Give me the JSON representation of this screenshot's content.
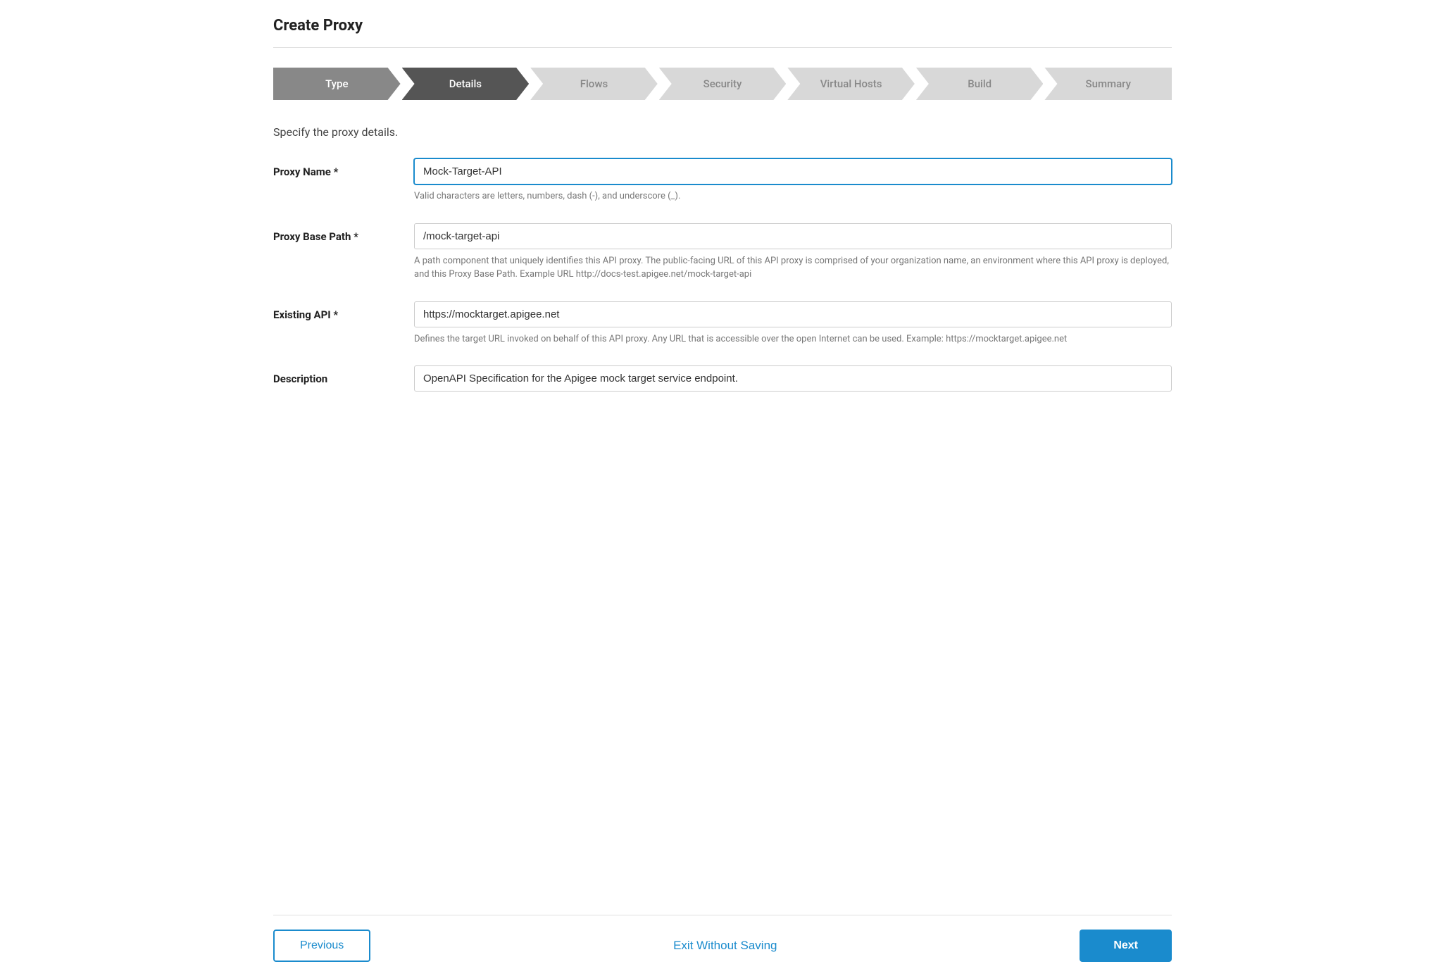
{
  "page": {
    "title": "Create Proxy"
  },
  "stepper": {
    "steps": [
      {
        "id": "type",
        "label": "Type",
        "state": "completed"
      },
      {
        "id": "details",
        "label": "Details",
        "state": "active"
      },
      {
        "id": "flows",
        "label": "Flows",
        "state": "inactive"
      },
      {
        "id": "security",
        "label": "Security",
        "state": "inactive"
      },
      {
        "id": "virtual-hosts",
        "label": "Virtual Hosts",
        "state": "inactive"
      },
      {
        "id": "build",
        "label": "Build",
        "state": "inactive"
      },
      {
        "id": "summary",
        "label": "Summary",
        "state": "inactive"
      }
    ]
  },
  "form": {
    "subtitle": "Specify the proxy details.",
    "proxy_name": {
      "label": "Proxy Name",
      "required": true,
      "value": "Mock-Target-API",
      "hint": "Valid characters are letters, numbers, dash (-), and underscore (_)."
    },
    "proxy_base_path": {
      "label": "Proxy Base Path",
      "required": true,
      "value": "/mock-target-api",
      "hint": "A path component that uniquely identifies this API proxy. The public-facing URL of this API proxy is comprised of your organization name, an environment where this API proxy is deployed, and this Proxy Base Path. Example URL http://docs-test.apigee.net/mock-target-api"
    },
    "existing_api": {
      "label": "Existing API",
      "required": true,
      "value": "https://mocktarget.apigee.net",
      "hint": "Defines the target URL invoked on behalf of this API proxy. Any URL that is accessible over the open Internet can be used. Example: https://mocktarget.apigee.net"
    },
    "description": {
      "label": "Description",
      "required": false,
      "value": "OpenAPI Specification for the Apigee mock target service endpoint.",
      "hint": ""
    }
  },
  "footer": {
    "previous_label": "Previous",
    "exit_label": "Exit Without Saving",
    "next_label": "Next"
  }
}
